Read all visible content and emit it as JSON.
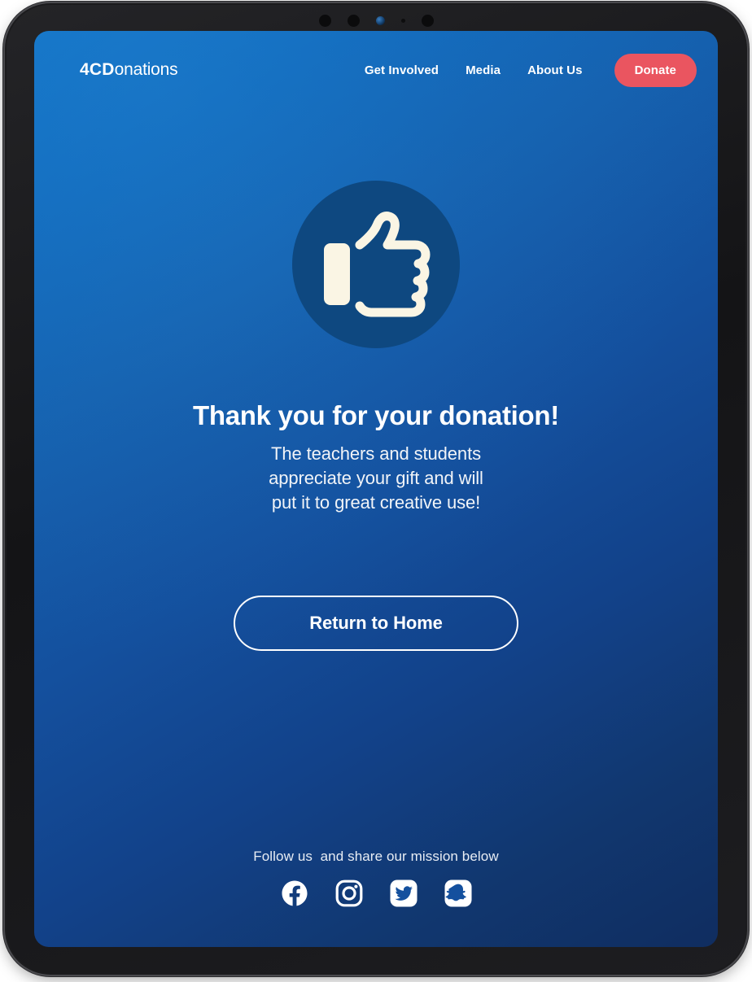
{
  "device": {
    "type": "tablet-frame",
    "sensors": [
      "sensor-dot",
      "sensor-dot",
      "camera-lens",
      "sensor-tiny",
      "sensor-dot"
    ]
  },
  "colors": {
    "bg_gradient_start": "#1272c6",
    "bg_gradient_mid": "#14509e",
    "bg_gradient_end": "#102d60",
    "donate_red": "#ea5560",
    "badge_circle": "#0e4880",
    "icon_cream": "#faf5e4",
    "text_white": "#ffffff"
  },
  "header": {
    "brand": {
      "mark": "4CD",
      "rest": "onations",
      "full": "4CDonations"
    },
    "nav_links": [
      {
        "label": "Get Involved"
      },
      {
        "label": "Media"
      },
      {
        "label": "About Us"
      }
    ],
    "donate_label": "Donate"
  },
  "main": {
    "badge_icon": "thumbs-up-icon",
    "headline": "Thank you for your donation!",
    "subcopy_lines": [
      "The teachers and students",
      "appreciate your gift and will",
      "put it to great creative use!"
    ],
    "return_home_label": "Return to Home"
  },
  "footer": {
    "follow_text": "Follow us  and share our mission below",
    "social": [
      {
        "name": "facebook-icon",
        "label": "Facebook"
      },
      {
        "name": "instagram-icon",
        "label": "Instagram"
      },
      {
        "name": "twitter-icon",
        "label": "Twitter"
      },
      {
        "name": "snapchat-icon",
        "label": "Snapchat"
      }
    ]
  }
}
